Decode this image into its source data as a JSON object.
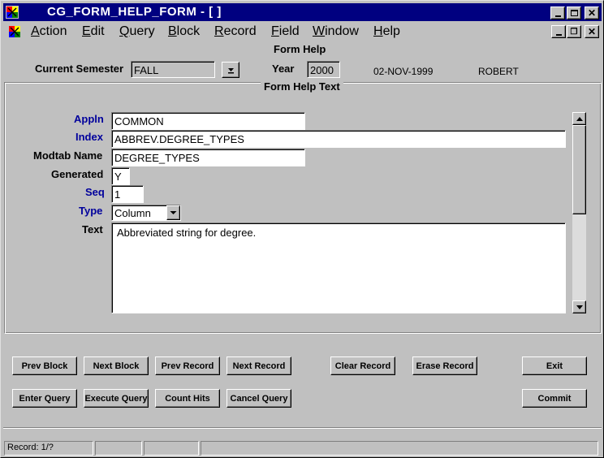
{
  "window": {
    "title": "CG_FORM_HELP_FORM - [ ]"
  },
  "menu": {
    "items": [
      {
        "first": "A",
        "rest": "ction"
      },
      {
        "first": "E",
        "rest": "dit"
      },
      {
        "first": "Q",
        "rest": "uery"
      },
      {
        "first": "B",
        "rest": "lock"
      },
      {
        "first": "R",
        "rest": "ecord"
      },
      {
        "first": "F",
        "rest": "ield"
      },
      {
        "first": "W",
        "rest": "indow"
      },
      {
        "first": "H",
        "rest": "elp"
      }
    ]
  },
  "header": {
    "form_title": "Form Help",
    "current_semester_label": "Current Semester",
    "current_semester_value": "FALL",
    "year_label": "Year",
    "year_value": "2000",
    "date": "02-NOV-1999",
    "user": "ROBERT"
  },
  "frame": {
    "title": "Form Help Text"
  },
  "form": {
    "appln_label": "Appln",
    "appln_value": "COMMON",
    "index_label": "Index",
    "index_value": "ABBREV.DEGREE_TYPES",
    "modtab_label": "Modtab Name",
    "modtab_value": "DEGREE_TYPES",
    "generated_label": "Generated",
    "generated_value": "Y",
    "seq_label": "Seq",
    "seq_value": "1",
    "type_label": "Type",
    "type_value": "Column",
    "text_label": "Text",
    "text_value": "Abbreviated string for degree."
  },
  "buttons": {
    "prev_block": "Prev Block",
    "next_block": "Next Block",
    "prev_record": "Prev Record",
    "next_record": "Next Record",
    "clear_record": "Clear Record",
    "erase_record": "Erase Record",
    "exit": "Exit",
    "enter_query": "Enter Query",
    "execute_query": "Execute Query",
    "count_hits": "Count Hits",
    "cancel_query": "Cancel Query",
    "commit": "Commit"
  },
  "status": {
    "record": "Record: 1/?"
  },
  "colors": {
    "titlebar": "#000080",
    "window_bg": "#c0c0c0",
    "blue_label": "#00009c"
  },
  "icons": {
    "app": "oracle-forms-app-icon",
    "doc": "oracle-forms-doc-icon"
  }
}
